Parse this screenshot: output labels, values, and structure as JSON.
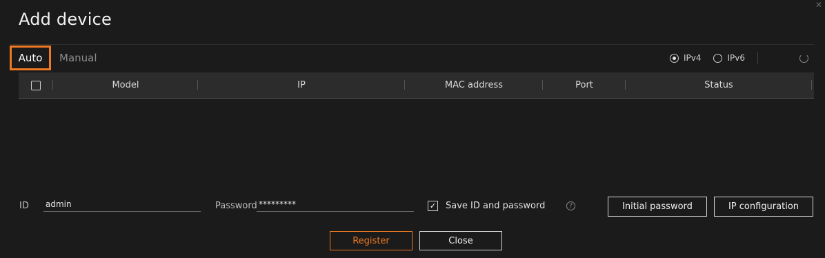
{
  "dialog": {
    "title": "Add device"
  },
  "tabs": [
    {
      "label": "Auto"
    },
    {
      "label": "Manual"
    }
  ],
  "ip_version": {
    "options": [
      "IPv4",
      "IPv6"
    ],
    "selected": "IPv4"
  },
  "table": {
    "columns": [
      "Model",
      "IP",
      "MAC address",
      "Port",
      "Status"
    ],
    "rows": []
  },
  "credentials": {
    "id_label": "ID",
    "id_value": "admin",
    "password_label": "Password",
    "password_value": "*********",
    "save_label": "Save ID and password",
    "save_checked": true,
    "help_glyph": "?"
  },
  "buttons": {
    "initial_password": "Initial password",
    "ip_configuration": "IP configuration",
    "register": "Register",
    "close": "Close"
  },
  "colors": {
    "accent": "#f07a22",
    "background": "#1b1b1b",
    "header_bg": "#2c2c2c"
  }
}
